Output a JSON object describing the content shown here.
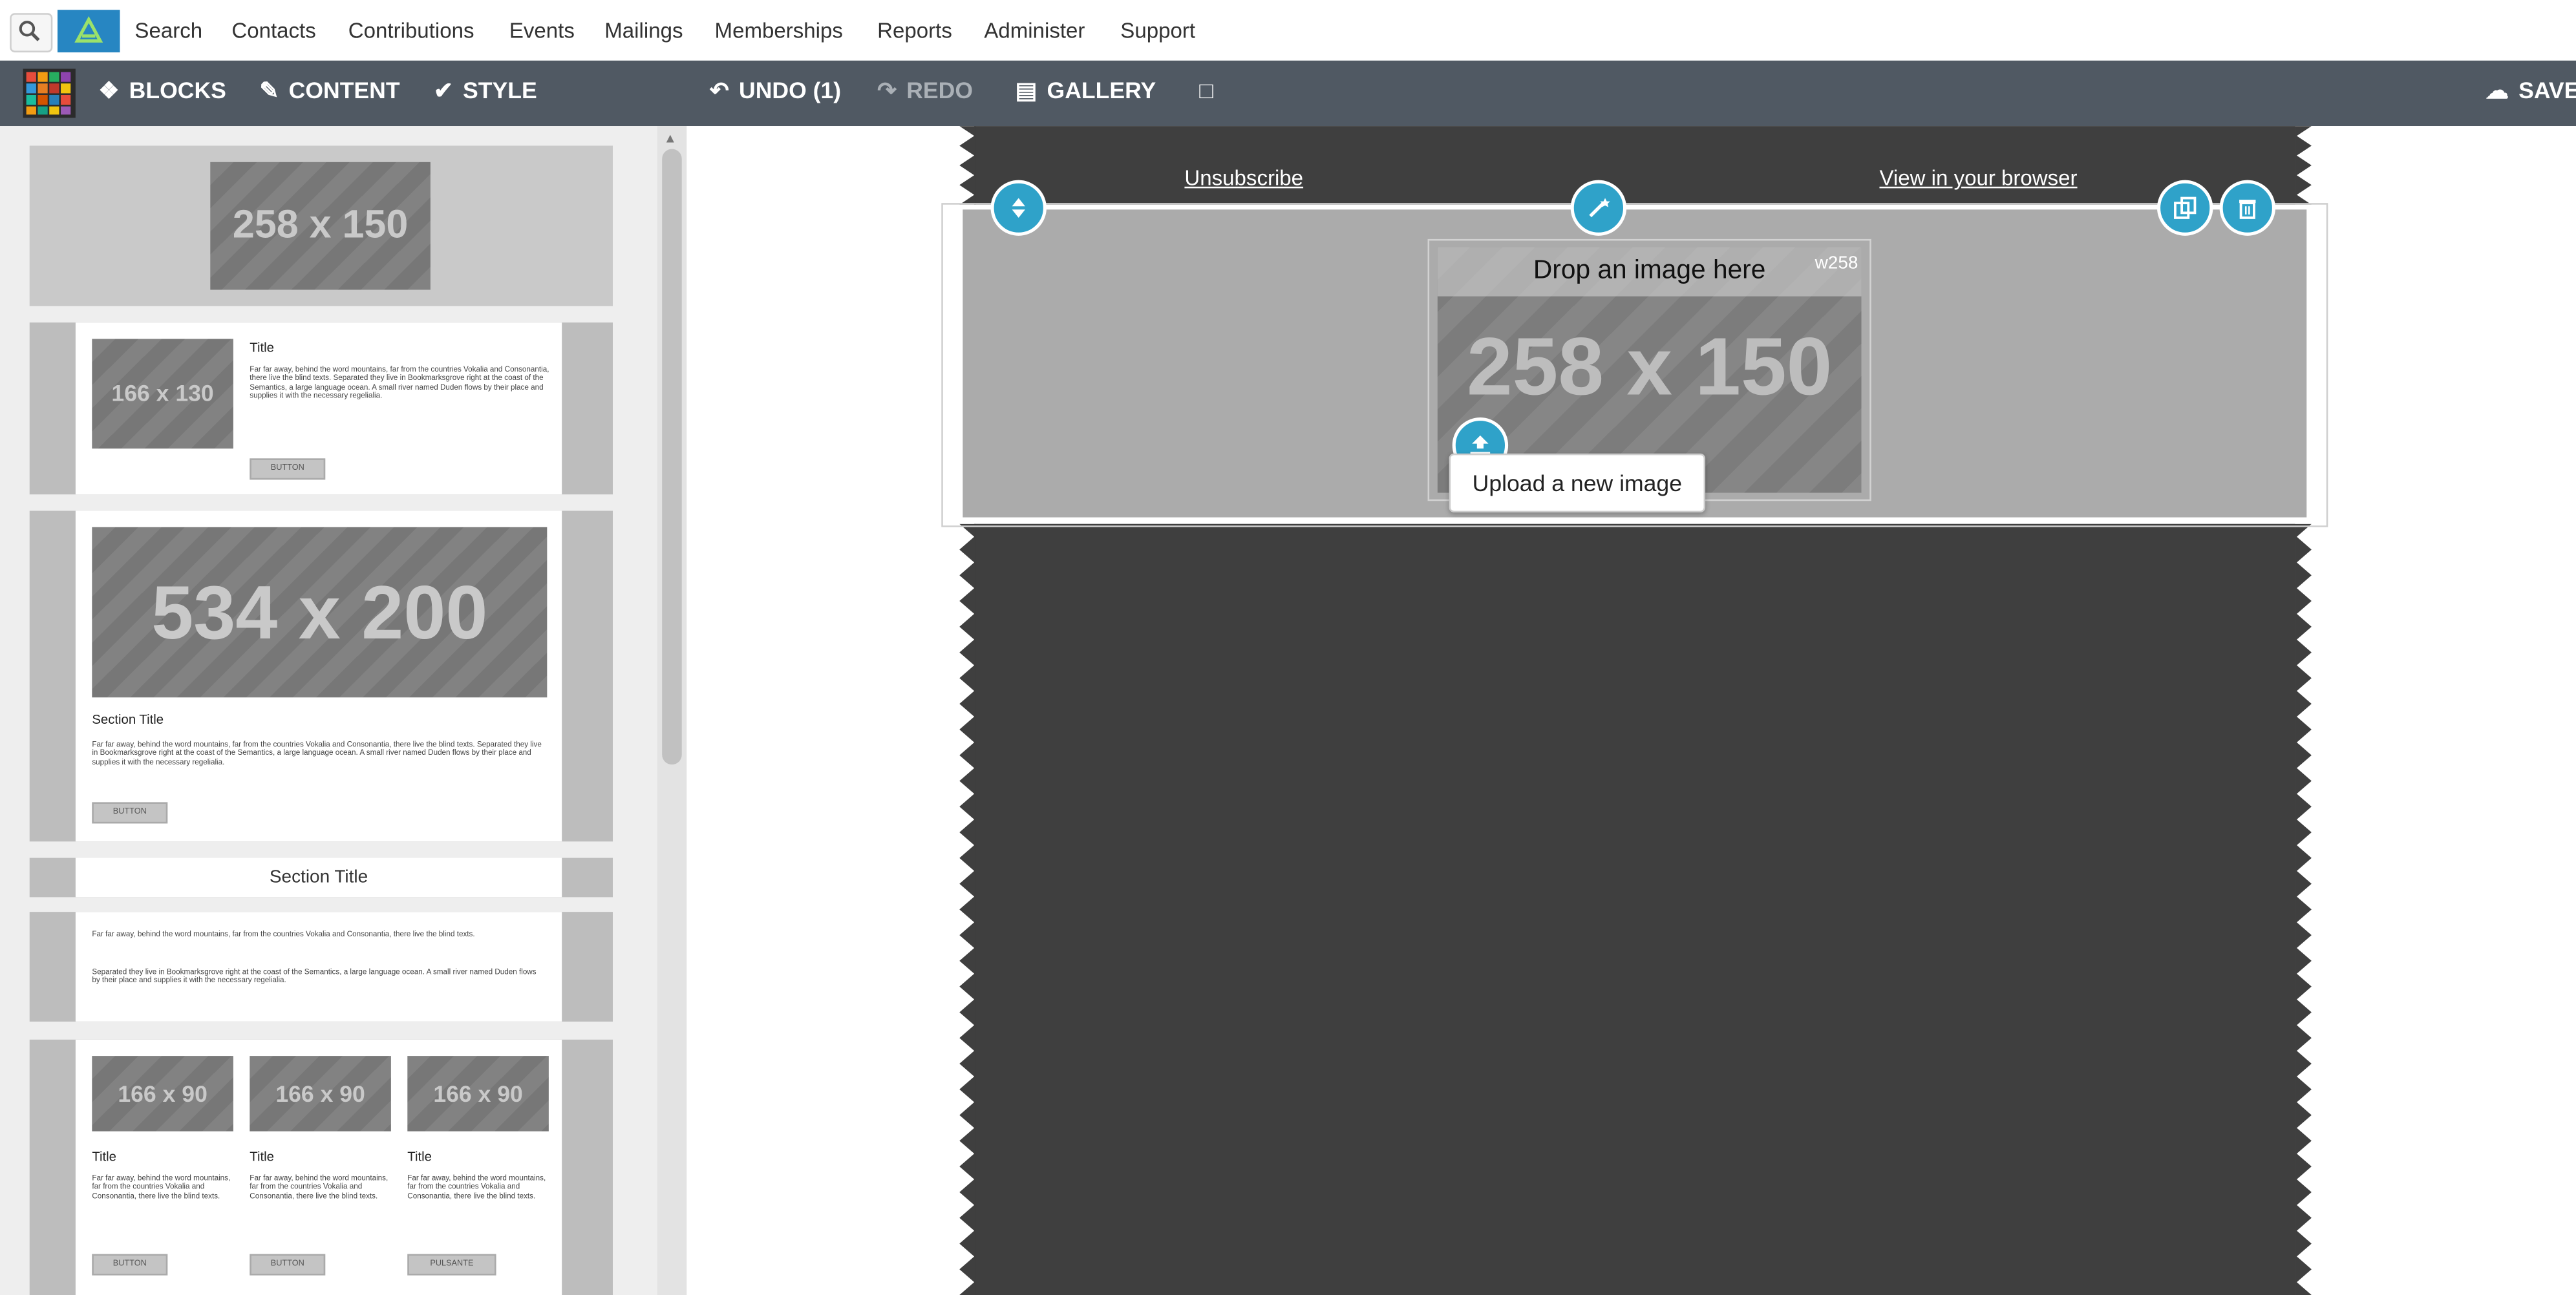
{
  "top_menu": {
    "items": [
      "Search",
      "Contacts",
      "Contributions",
      "Events",
      "Mailings",
      "Memberships",
      "Reports",
      "Administer",
      "Support"
    ]
  },
  "toolbar": {
    "blocks": "BLOCKS",
    "content": "CONTENT",
    "style": "STYLE",
    "undo": "UNDO (1)",
    "redo": "REDO",
    "gallery": "GALLERY",
    "save": "SAVE"
  },
  "blocks": {
    "b1_image": "258 x 150",
    "b2_image": "166 x 130",
    "b2_title": "Title",
    "b2_text": "Far far away, behind the word mountains, far from the countries Vokalia and Consonantia, there live the blind texts. Separated they live in Bookmarksgrove right at the coast of the Semantics, a large language ocean. A small river named Duden flows by their place and supplies it with the necessary regelialia.",
    "b2_button": "BUTTON",
    "b3_image": "534 x 200",
    "b3_title": "Section Title",
    "b3_text": "Far far away, behind the word mountains, far from the countries Vokalia and Consonantia, there live the blind texts. Separated they live in Bookmarksgrove right at the coast of the Semantics, a large language ocean. A small river named Duden flows by their place and supplies it with the necessary regelialia.",
    "b3_button": "BUTTON",
    "b4_title": "Section Title",
    "b5_text1": "Far far away, behind the word mountains, far from the countries Vokalia and Consonantia, there live the blind texts.",
    "b5_text2": "Separated they live in Bookmarksgrove right at the coast of the Semantics, a large language ocean. A small river named Duden flows by their place and supplies it with the necessary regelialia.",
    "b6_cols": [
      {
        "image": "166 x 90",
        "title": "Title",
        "text": "Far far away, behind the word mountains, far from the countries Vokalia and Consonantia, there live the blind texts.",
        "button": "BUTTON"
      },
      {
        "image": "166 x 90",
        "title": "Title",
        "text": "Far far away, behind the word mountains, far from the countries Vokalia and Consonantia, there live the blind texts.",
        "button": "BUTTON"
      },
      {
        "image": "166 x 90",
        "title": "Title",
        "text": "Far far away, behind the word mountains, far from the countries Vokalia and Consonantia, there live the blind texts.",
        "button": "PULSANTE"
      }
    ]
  },
  "canvas": {
    "unsubscribe": "Unsubscribe",
    "view_browser": "View in your browser",
    "drop_text": "Drop an image here",
    "width_tag": "w258",
    "placeholder": "258 x 150",
    "tooltip": "Upload a new image"
  },
  "colors": {
    "toolbar_bg": "#505963",
    "accent": "#2fa2c9",
    "canvas_dark": "#3f3f3f",
    "logo_bg": "#2786c2"
  }
}
